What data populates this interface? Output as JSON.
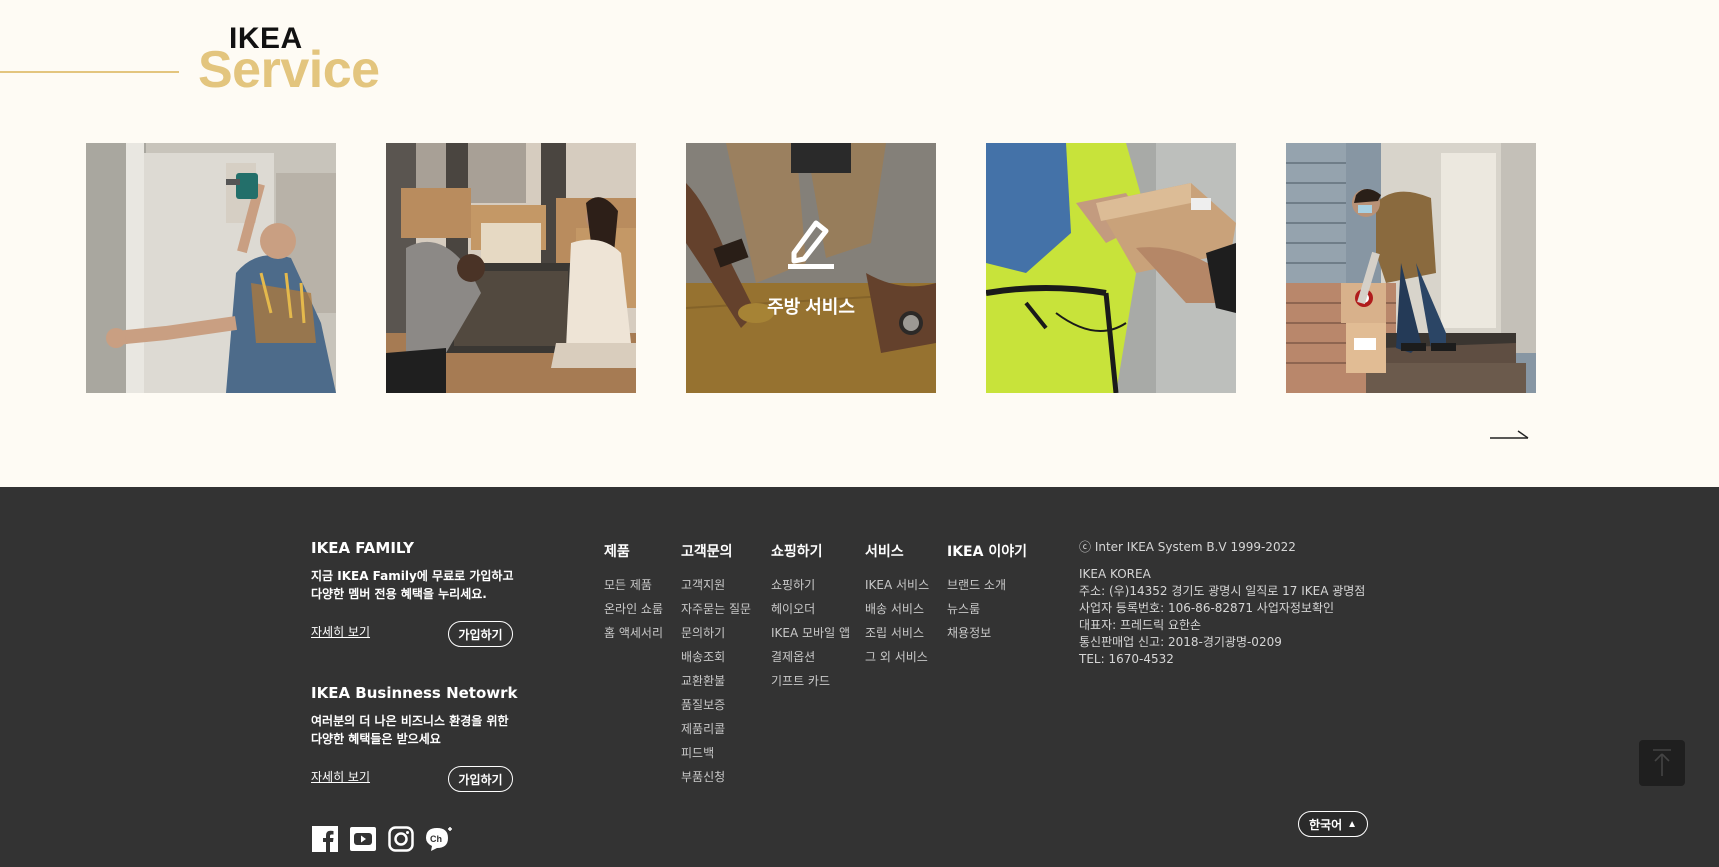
{
  "service": {
    "brand_top": "IKEA",
    "brand_bottom": "Service",
    "cards": [
      {
        "id": "assembly",
        "label": ""
      },
      {
        "id": "moving",
        "label": ""
      },
      {
        "id": "kitchen",
        "label": "주방 서비스"
      },
      {
        "id": "delivery",
        "label": ""
      },
      {
        "id": "doorstep",
        "label": ""
      }
    ],
    "next_icon": "arrow-right-icon"
  },
  "footer": {
    "family": {
      "title": "IKEA FAMILY",
      "desc_line1": "지금 IKEA Family에 무료로 가입하고",
      "desc_line2": "다양한 멤버 전용 혜택을 누리세요.",
      "more": "자세히 보기",
      "join": "가입하기"
    },
    "business": {
      "title": "IKEA Businness Netowrk",
      "desc_line1": "여러분의 더 나은 비즈니스 환경을 위한",
      "desc_line2": "다양한 혜택들은 받으세요",
      "more": "자세히 보기",
      "join": "가입하기"
    },
    "menus": [
      {
        "title": "제품",
        "items": [
          "모든 제품",
          "온라인 쇼룸",
          "홈 액세서리"
        ]
      },
      {
        "title": "고객문의",
        "items": [
          "고객지원",
          "자주묻는 질문",
          "문의하기",
          "배송조회",
          "교환환불",
          "품질보증",
          "제품리콜",
          "피드백",
          "부품신청"
        ]
      },
      {
        "title": "쇼핑하기",
        "items": [
          "쇼핑하기",
          "헤이오더",
          "IKEA 모바일 앱",
          "결제옵션",
          "기프트 카드"
        ]
      },
      {
        "title": "서비스",
        "items": [
          "IKEA 서비스",
          "배송 서비스",
          "조립 서비스",
          "그 외 서비스"
        ]
      },
      {
        "title": "IKEA 이야기",
        "items": [
          "브랜드 소개",
          "뉴스룸",
          "채용정보"
        ]
      }
    ],
    "company": {
      "copyright": "ⓒ Inter IKEA System B.V 1999-2022",
      "name": "IKEA KOREA",
      "address": "주소: (우)14352 경기도 광명시 일직로 17 IKEA 광명점",
      "biz_no": "사업자 등록번호: 106-86-82871 사업자정보확인",
      "ceo": "대표자: 프레드릭 요한손",
      "mail_order": "통신판매업 신고: 2018-경기광명-0209",
      "tel": "TEL: 1670-4532"
    },
    "social": [
      "facebook-icon",
      "youtube-icon",
      "instagram-icon",
      "kakao-channel-icon"
    ],
    "language": "한국어",
    "language_arrow": "▲",
    "top_icon": "arrow-up-icon"
  },
  "colors": {
    "page_bg": "#fefbf4",
    "accent_gold": "#e3c57e",
    "footer_bg": "#333333"
  }
}
